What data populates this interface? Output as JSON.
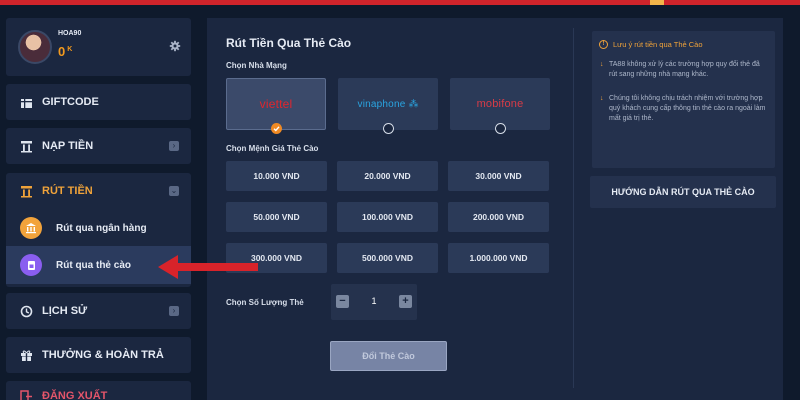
{
  "user": {
    "username": "HOA90",
    "balance": "0",
    "balance_unit": "K"
  },
  "sidebar": {
    "items": [
      {
        "label": "GIFTCODE",
        "icon": "gift-icon"
      },
      {
        "label": "NẠP TIỀN",
        "icon": "deposit-icon"
      },
      {
        "label": "RÚT TIỀN",
        "icon": "withdraw-icon",
        "expanded": true
      },
      {
        "label": "LỊCH SỬ",
        "icon": "history-icon"
      },
      {
        "label": "THƯỞNG & HOÀN TRẢ",
        "icon": "reward-icon"
      },
      {
        "label": "ĐĂNG XUẤT",
        "icon": "logout-icon"
      }
    ],
    "sub_items": [
      {
        "label": "Rút qua ngân hàng",
        "icon": "bank-icon"
      },
      {
        "label": "Rút qua thẻ cào",
        "icon": "card-icon",
        "active": true
      }
    ]
  },
  "main": {
    "title": "Rút Tiền Qua Thẻ Cào",
    "network_label": "Chọn Nhà Mạng",
    "networks": [
      {
        "name": "viettel",
        "color": "#e1262d",
        "selected": true
      },
      {
        "name": "vinaphone",
        "color": "#2aa4e0",
        "selected": false
      },
      {
        "name": "mobifone",
        "color": "#d73c47",
        "selected": false
      }
    ],
    "denomination_label": "Chọn Mệnh Giá Thẻ Cào",
    "denominations": [
      "10.000 VND",
      "20.000 VND",
      "30.000 VND",
      "50.000 VND",
      "100.000 VND",
      "200.000 VND",
      "300.000 VND",
      "500.000 VND",
      "1.000.000 VND"
    ],
    "quantity_label": "Chọn Số Lượng Thẻ",
    "quantity": "1",
    "minus": "−",
    "plus": "+",
    "submit_label": "Đổi Thẻ Cào"
  },
  "notes": {
    "title": "Lưu ý rút tiền qua Thẻ Cào",
    "items": [
      "TA88 không xử lý các trường hợp quy đổi thẻ đã rút sang những nhà mạng khác.",
      "Chúng tôi không chịu trách nhiệm với trường hợp quý khách cung cấp thông tin thẻ cào ra ngoài làm mất giá trị thẻ."
    ],
    "guide_label": "HƯỚNG DẪN RÚT QUA THẺ CÀO"
  },
  "colors": {
    "accent": "#f08a24",
    "panel": "#1b2740",
    "background": "#0f1a2c",
    "arrow": "#d8232a"
  }
}
